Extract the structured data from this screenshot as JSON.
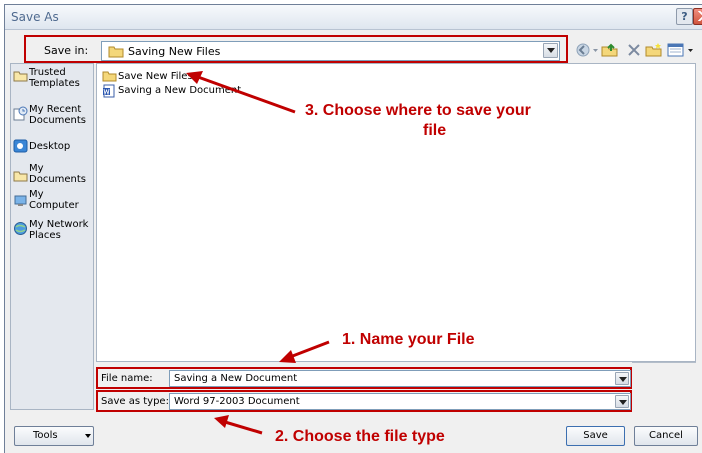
{
  "window": {
    "title": "Save As"
  },
  "save_in": {
    "label": "Save in:",
    "value": "Saving New Files"
  },
  "places": [
    {
      "label": "Trusted\nTemplates",
      "icon": "folder-icon"
    },
    {
      "label": "My Recent\nDocuments",
      "icon": "recent-documents-icon"
    },
    {
      "label": "Desktop",
      "icon": "desktop-icon"
    },
    {
      "label": "My\nDocuments",
      "icon": "my-documents-icon"
    },
    {
      "label": "My\nComputer",
      "icon": "computer-icon"
    },
    {
      "label": "My Network\nPlaces",
      "icon": "network-places-icon"
    }
  ],
  "files": [
    {
      "name": "Save New Files",
      "icon": "folder-icon"
    },
    {
      "name": "Saving a New Document",
      "icon": "word-document-icon"
    }
  ],
  "annotations": {
    "step3_line1": "3.  Choose where to save your",
    "step3_line2": "file",
    "step1": "1.  Name your File",
    "step2": "2.  Choose the file type"
  },
  "file_name": {
    "label": "File name:",
    "value": "Saving a New Document"
  },
  "save_as_type": {
    "label": "Save as type:",
    "value": "Word 97-2003 Document"
  },
  "buttons": {
    "tools": "Tools",
    "save": "Save",
    "cancel": "Cancel"
  },
  "colors": {
    "annotation": "#c00000",
    "titlebar_text": "#4f6a8f"
  }
}
